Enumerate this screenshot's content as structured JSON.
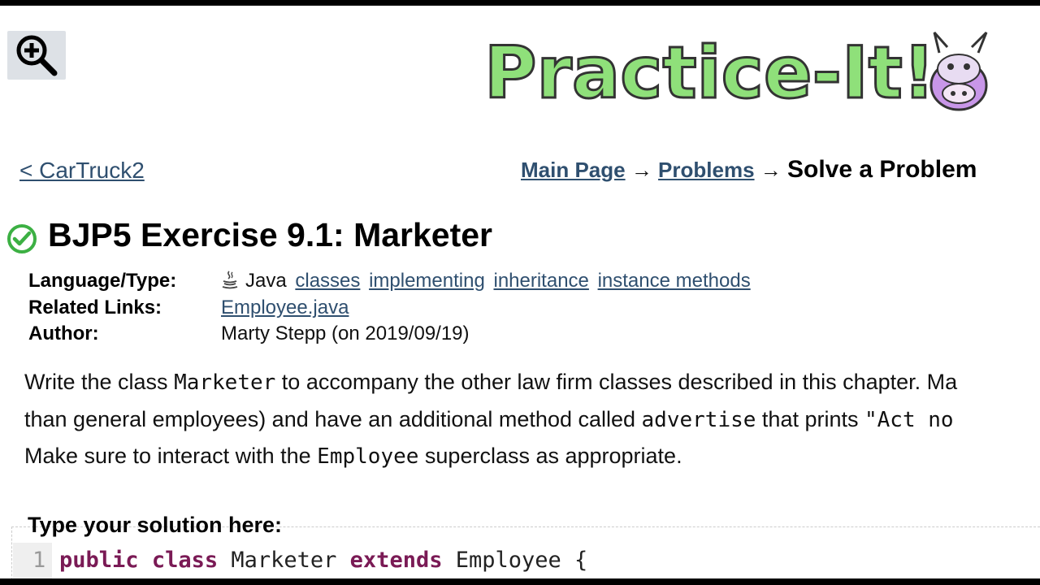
{
  "header": {
    "logo_text": "Practice-It!",
    "zoom_icon": "zoom-in-icon"
  },
  "nav": {
    "prev_link": "< CarTruck2",
    "breadcrumb": {
      "main_page": "Main Page",
      "sep1": " → ",
      "problems": "Problems",
      "sep2": " → ",
      "current": "Solve a Problem"
    }
  },
  "problem": {
    "status_icon": "check-circle-icon",
    "title": "BJP5 Exercise 9.1: Marketer",
    "meta": {
      "language_label": "Language/Type:",
      "language": "Java",
      "java_icon": "java-cup-icon",
      "tags": [
        "classes",
        "implementing",
        "inheritance",
        "instance methods"
      ],
      "related_label": "Related Links:",
      "related_link": "Employee.java",
      "author_label": "Author:",
      "author": "Marty Stepp (on 2019/09/19)"
    },
    "description": {
      "l1_a": "Write the class ",
      "l1_code": "Marketer",
      "l1_b": " to accompany the other law firm classes described in this chapter. Ma",
      "l2_a": "than general employees) and have an additional method called ",
      "l2_code": "advertise",
      "l2_b": " that prints ",
      "l2_code2": "\"Act no",
      "l3_a": "Make sure to interact with the ",
      "l3_code": "Employee",
      "l3_b": " superclass as appropriate."
    }
  },
  "editor": {
    "label": "Type your solution here:",
    "line1_number": "1",
    "line1": {
      "kw1": "public",
      "kw2": "class",
      "name": "Marketer",
      "kw3": "extends",
      "parent": "Employee {"
    }
  },
  "colors": {
    "link": "#2f4f6f",
    "keyword": "#7a1a55",
    "logo_green": "#8fe07a",
    "check_green": "#3cb043"
  }
}
